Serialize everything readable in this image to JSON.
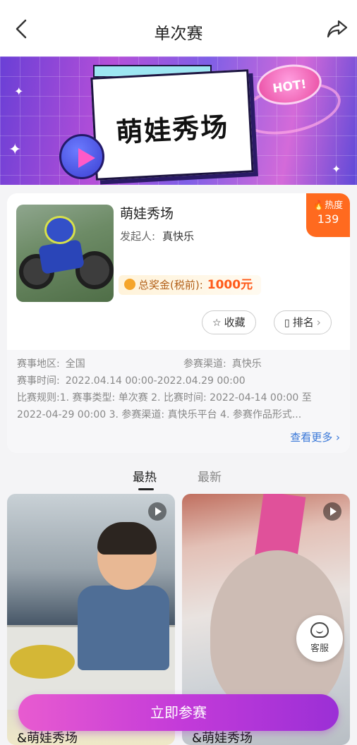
{
  "header": {
    "title": "单次赛"
  },
  "banner": {
    "title": "萌娃秀场",
    "badge": "HOT!"
  },
  "contest": {
    "name": "萌娃秀场",
    "sponsor_label": "发起人:",
    "sponsor": "真快乐",
    "heat_label": "热度",
    "heat_value": "139",
    "prize_label": "总奖金(税前):",
    "prize_value": "1000元",
    "favorite_label": "收藏",
    "ranking_label": "排名"
  },
  "details": {
    "region_label": "赛事地区:",
    "region": "全国",
    "channel_label": "参赛渠道:",
    "channel": "真快乐",
    "time_label": "赛事时间:",
    "time": "2022.04.14 00:00-2022.04.29 00:00",
    "rules_label": "比赛规则:",
    "rules": "1. 赛事类型: 单次赛 2. 比赛时间: 2022-04-14 00:00 至 2022-04-29 00:00 3. 参赛渠道: 真快乐平台 4. 参赛作品形式...",
    "more": "查看更多"
  },
  "tabs": [
    {
      "label": "最热"
    },
    {
      "label": "最新"
    }
  ],
  "feed": [
    {
      "caption": "&萌娃秀场"
    },
    {
      "caption": "&萌娃秀场"
    }
  ],
  "kefu": {
    "label": "客服"
  },
  "join_button": "立即参赛"
}
